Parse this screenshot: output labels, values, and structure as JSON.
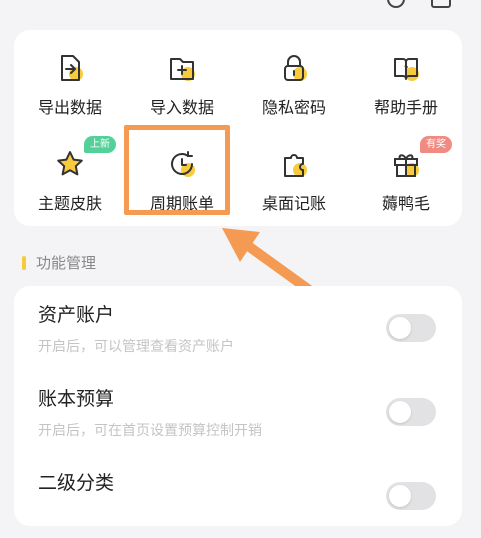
{
  "colors": {
    "accent_yellow": "#f7cb3b",
    "highlight_orange": "#f59a52",
    "toggle_off": "#e2e2e4"
  },
  "shortcuts": [
    {
      "label": "导出数据",
      "icon": "export-file-icon"
    },
    {
      "label": "导入数据",
      "icon": "import-folder-icon"
    },
    {
      "label": "隐私密码",
      "icon": "lock-icon"
    },
    {
      "label": "帮助手册",
      "icon": "help-book-icon"
    },
    {
      "label": "主题皮肤",
      "icon": "star-icon",
      "badge": "上新"
    },
    {
      "label": "周期账单",
      "icon": "cycle-clock-icon"
    },
    {
      "label": "桌面记账",
      "icon": "widget-icon"
    },
    {
      "label": "薅鸭毛",
      "icon": "gift-icon",
      "badge": "有奖"
    }
  ],
  "section": {
    "title": "功能管理"
  },
  "settings": [
    {
      "title": "资产账户",
      "desc": "开启后，可以管理查看资产账户",
      "enabled": false
    },
    {
      "title": "账本预算",
      "desc": "开启后，可在首页设置预算控制开销",
      "enabled": false
    },
    {
      "title": "二级分类",
      "desc": "",
      "enabled": false
    }
  ]
}
